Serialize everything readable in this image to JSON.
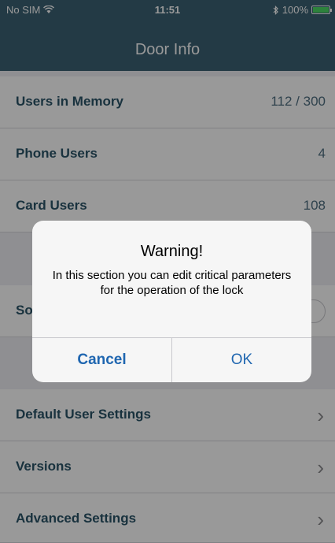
{
  "status_bar": {
    "carrier": "No SIM",
    "time": "11:51",
    "battery_text": "100%",
    "wifi_icon": "wifi-icon",
    "bluetooth_icon": "bluetooth-icon",
    "battery_icon": "battery-icon",
    "battery_level": 1.0
  },
  "nav": {
    "title": "Door Info"
  },
  "rows": [
    {
      "label": "Users in Memory",
      "value": "112 / 300"
    },
    {
      "label": "Phone Users",
      "value": "4"
    },
    {
      "label": "Card Users",
      "value": "108"
    }
  ],
  "settings_row": {
    "label_partial": "So"
  },
  "menu": [
    {
      "label": "Default User Settings"
    },
    {
      "label": "Versions"
    },
    {
      "label": "Advanced Settings"
    }
  ],
  "alert": {
    "title": "Warning!",
    "message": "In this section you can edit critical parameters for the operation of the lock",
    "cancel_label": "Cancel",
    "ok_label": "OK"
  },
  "colors": {
    "nav_bg": "#3b6274",
    "label_color": "#2a5468",
    "button_color": "#1f66b0"
  }
}
